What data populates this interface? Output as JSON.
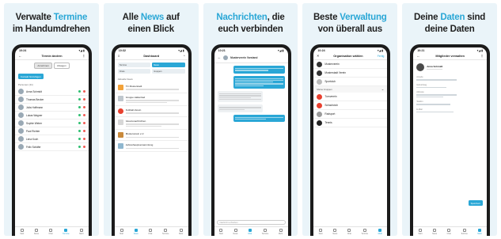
{
  "panels": [
    {
      "caption_line1": "Verwalte",
      "caption_highlight": "Termine",
      "caption_line2": "im Handumdrehen",
      "screen": {
        "time": "10:24",
        "title": "Termin ändern",
        "tab_a": "Annehmen",
        "tab_b": "Absagen",
        "button": "Kontakt hinzufügen",
        "section": "Personen (11)",
        "people": [
          "Anna Schmidt",
          "Thomas Becker",
          "Julia Hoffmann",
          "Lukas Wagner",
          "Sophie Weber",
          "Paul Richter",
          "Lena Koch",
          "Felix Schäfer"
        ]
      }
    },
    {
      "caption_line1": "Alle",
      "caption_highlight": "News",
      "caption_line1_after": "auf",
      "caption_line2": "einen Blick",
      "screen": {
        "time": "10:32",
        "title": "Dashboard",
        "tiles": [
          "Termine",
          "News",
          "Chats",
          "Gruppen"
        ],
        "section": "Aktuelle News",
        "news": [
          "TC Musterstadt",
          "Gruppe Hallenbad",
          "Fußball-Verein",
          "Vereinsnachrichten",
          "Musterverein e.V.",
          "Jahreshauptversammlung"
        ]
      }
    },
    {
      "caption_highlight": "Nachrichten",
      "caption_line1_after": ", die",
      "caption_line2": "euch verbinden",
      "screen": {
        "time": "10:21",
        "title": "Musterverein Vorstand",
        "composer_placeholder": "Nachricht schreiben"
      }
    },
    {
      "caption_line1": "Beste",
      "caption_highlight": "Verwaltung",
      "caption_line2": "von überall aus",
      "screen": {
        "time": "10:24",
        "title": "Organisation wählen",
        "action": "Fertig",
        "orgs": [
          "Musterverein",
          "Musterstadt Verein",
          "Sportclub",
          "Turnverein",
          "Schachclub",
          "Radsport",
          "Tennis"
        ],
        "section": "Meine Gruppen"
      }
    },
    {
      "caption_line1": "Deine",
      "caption_highlight": "Daten",
      "caption_line1_after": "sind",
      "caption_line2": "deine Daten",
      "screen": {
        "time": "10:21",
        "title": "Mitglieder verwalten",
        "name": "Anna Schmidt",
        "fields": [
          "Anrede",
          "Geburtstag",
          "Adresse",
          "Telefon",
          "E-Mail"
        ],
        "save": "Speichern"
      }
    }
  ],
  "nav": [
    "Start",
    "News",
    "Chat",
    "Termine",
    "Mehr"
  ],
  "colors": {
    "accent": "#2aa7d6",
    "panel_bg": "#eaf4f9"
  }
}
